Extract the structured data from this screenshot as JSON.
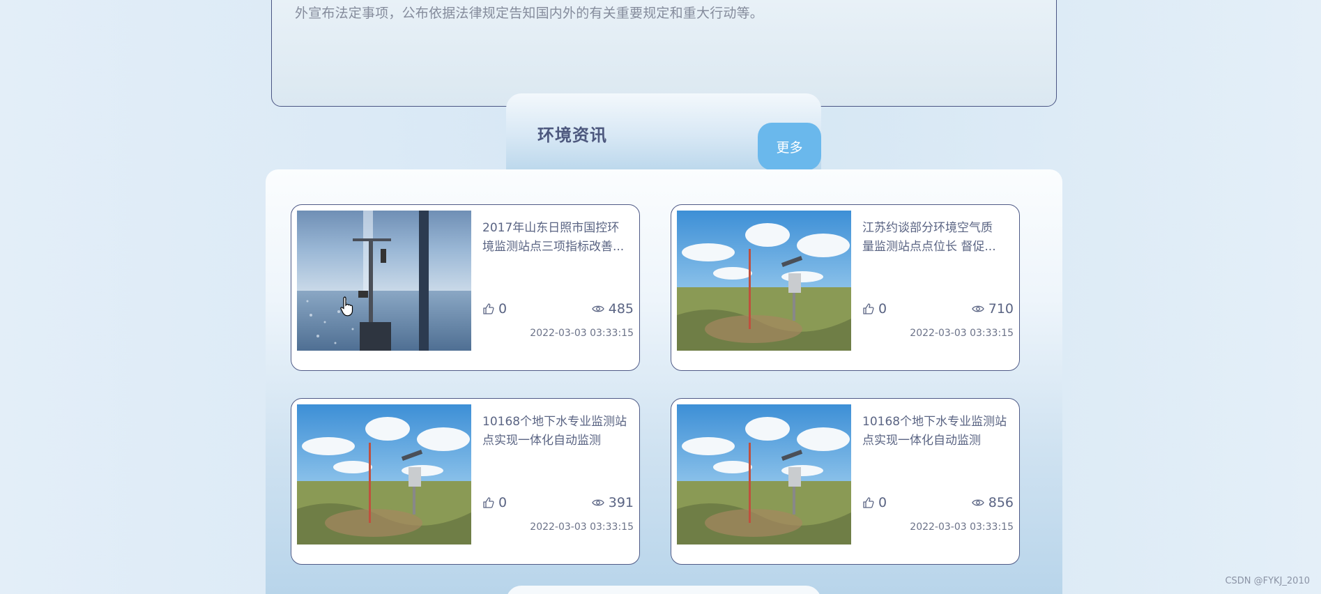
{
  "notice": {
    "text": "外宣布法定事项，公布依据法律规定告知国内外的有关重要规定和重大行动等。"
  },
  "section": {
    "title": "环境资讯",
    "more_label": "更多"
  },
  "news": [
    {
      "title_line1": "2017年山东日照市国控环",
      "title_line2": "境监测站点三项指标改善...",
      "likes": "0",
      "views": "485",
      "date": "2022-03-03 03:33:15",
      "image": "sea-station"
    },
    {
      "title_line1": "江苏约谈部分环境空气质",
      "title_line2": "量监测站点点位长 督促...",
      "likes": "0",
      "views": "710",
      "date": "2022-03-03 03:33:15",
      "image": "grassland-station"
    },
    {
      "title_line1": "10168个地下水专业监测站",
      "title_line2": "点实现一体化自动监测",
      "likes": "0",
      "views": "391",
      "date": "2022-03-03 03:33:15",
      "image": "grassland-station"
    },
    {
      "title_line1": "10168个地下水专业监测站",
      "title_line2": "点实现一体化自动监测",
      "likes": "0",
      "views": "856",
      "date": "2022-03-03 03:33:15",
      "image": "grassland-station"
    }
  ],
  "watermark": "CSDN @FYKJ_2010"
}
